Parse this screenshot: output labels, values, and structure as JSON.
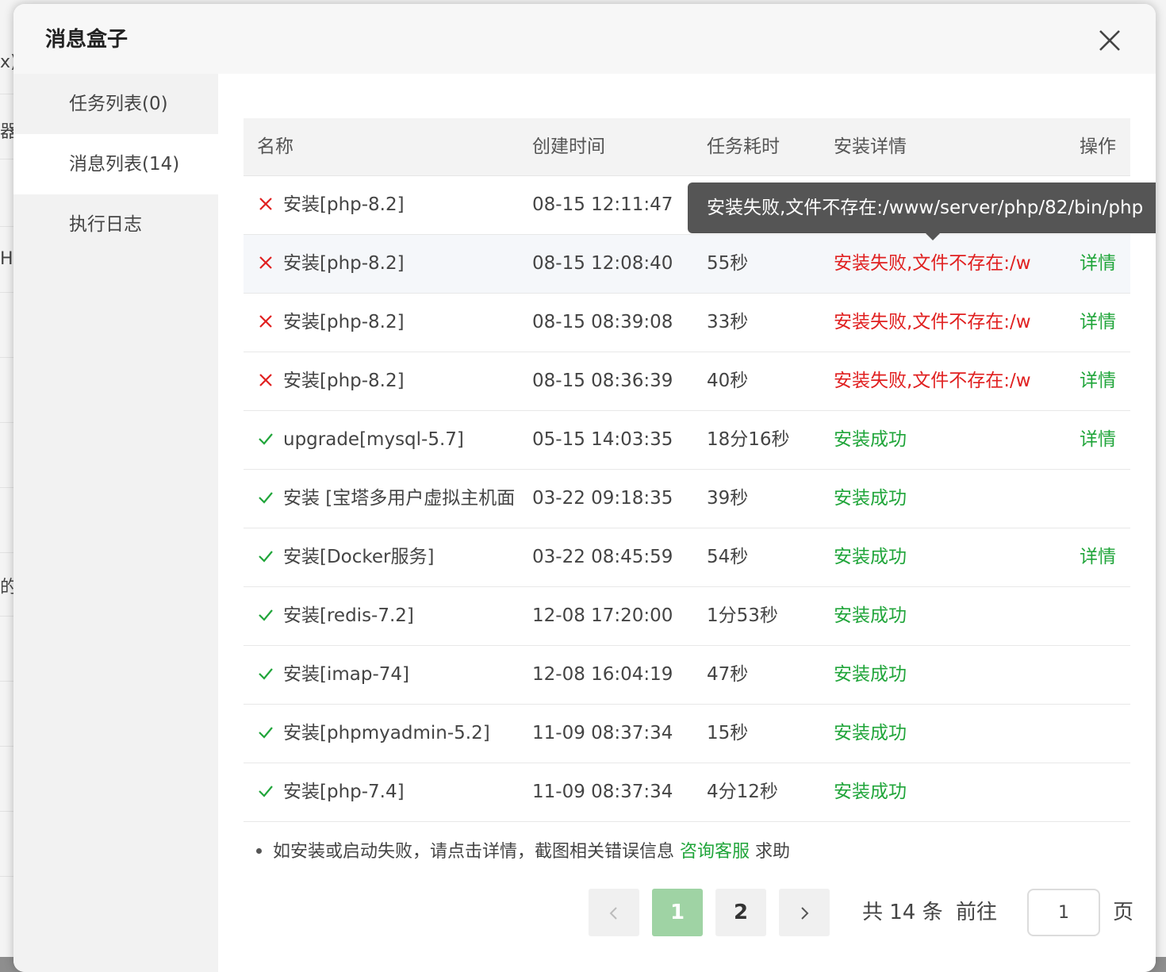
{
  "background": {
    "fragments": [
      "x)",
      "器",
      "H",
      "的"
    ]
  },
  "dialog": {
    "title": "消息盒子"
  },
  "sidebar": {
    "items": [
      {
        "label": "任务列表(0)"
      },
      {
        "label": "消息列表(14)"
      },
      {
        "label": "执行日志"
      }
    ],
    "active_index": 1
  },
  "table": {
    "headers": {
      "name": "名称",
      "created": "创建时间",
      "duration": "任务耗时",
      "detail": "安装详情",
      "action": "操作"
    },
    "rows": [
      {
        "status": "fail",
        "name": "安装[php-8.2]",
        "created": "08-15 12:11:47",
        "duration": "",
        "detail": "",
        "action": ""
      },
      {
        "status": "fail",
        "name": "安装[php-8.2]",
        "created": "08-15 12:08:40",
        "duration": "55秒",
        "detail": "安装失败,文件不存在:/w",
        "action": "详情"
      },
      {
        "status": "fail",
        "name": "安装[php-8.2]",
        "created": "08-15 08:39:08",
        "duration": "33秒",
        "detail": "安装失败,文件不存在:/w",
        "action": "详情"
      },
      {
        "status": "fail",
        "name": "安装[php-8.2]",
        "created": "08-15 08:36:39",
        "duration": "40秒",
        "detail": "安装失败,文件不存在:/w",
        "action": "详情"
      },
      {
        "status": "ok",
        "name": "upgrade[mysql-5.7]",
        "created": "05-15 14:03:35",
        "duration": "18分16秒",
        "detail": "安装成功",
        "action": "详情"
      },
      {
        "status": "ok",
        "name": "安装 [宝塔多用户虚拟主机面",
        "created": "03-22 09:18:35",
        "duration": "39秒",
        "detail": "安装成功",
        "action": ""
      },
      {
        "status": "ok",
        "name": "安装[Docker服务]",
        "created": "03-22 08:45:59",
        "duration": "54秒",
        "detail": "安装成功",
        "action": "详情"
      },
      {
        "status": "ok",
        "name": "安装[redis-7.2]",
        "created": "12-08 17:20:00",
        "duration": "1分53秒",
        "detail": "安装成功",
        "action": ""
      },
      {
        "status": "ok",
        "name": "安装[imap-74]",
        "created": "12-08 16:04:19",
        "duration": "47秒",
        "detail": "安装成功",
        "action": ""
      },
      {
        "status": "ok",
        "name": "安装[phpmyadmin-5.2]",
        "created": "11-09 08:37:34",
        "duration": "15秒",
        "detail": "安装成功",
        "action": ""
      },
      {
        "status": "ok",
        "name": "安装[php-7.4]",
        "created": "11-09 08:37:34",
        "duration": "4分12秒",
        "detail": "安装成功",
        "action": ""
      }
    ]
  },
  "tooltip": {
    "text": "安装失败,文件不存在:/www/server/php/82/bin/php"
  },
  "note": {
    "prefix": "如安装或启动失败，请点击详情，截图相关错误信息",
    "link": "咨询客服",
    "suffix": "求助"
  },
  "pagination": {
    "pages": [
      "1",
      "2"
    ],
    "current": "1",
    "total_text": "共 14 条",
    "goto_label": "前往",
    "page_input": "1",
    "page_unit": "页"
  },
  "colors": {
    "fail": "#e02020",
    "success": "#20a53a",
    "active_page": "#9fd3a4"
  },
  "icons": {
    "close": "close-icon",
    "fail": "cross-icon",
    "ok": "check-icon",
    "prev": "chevron-left-icon",
    "next": "chevron-right-icon"
  }
}
